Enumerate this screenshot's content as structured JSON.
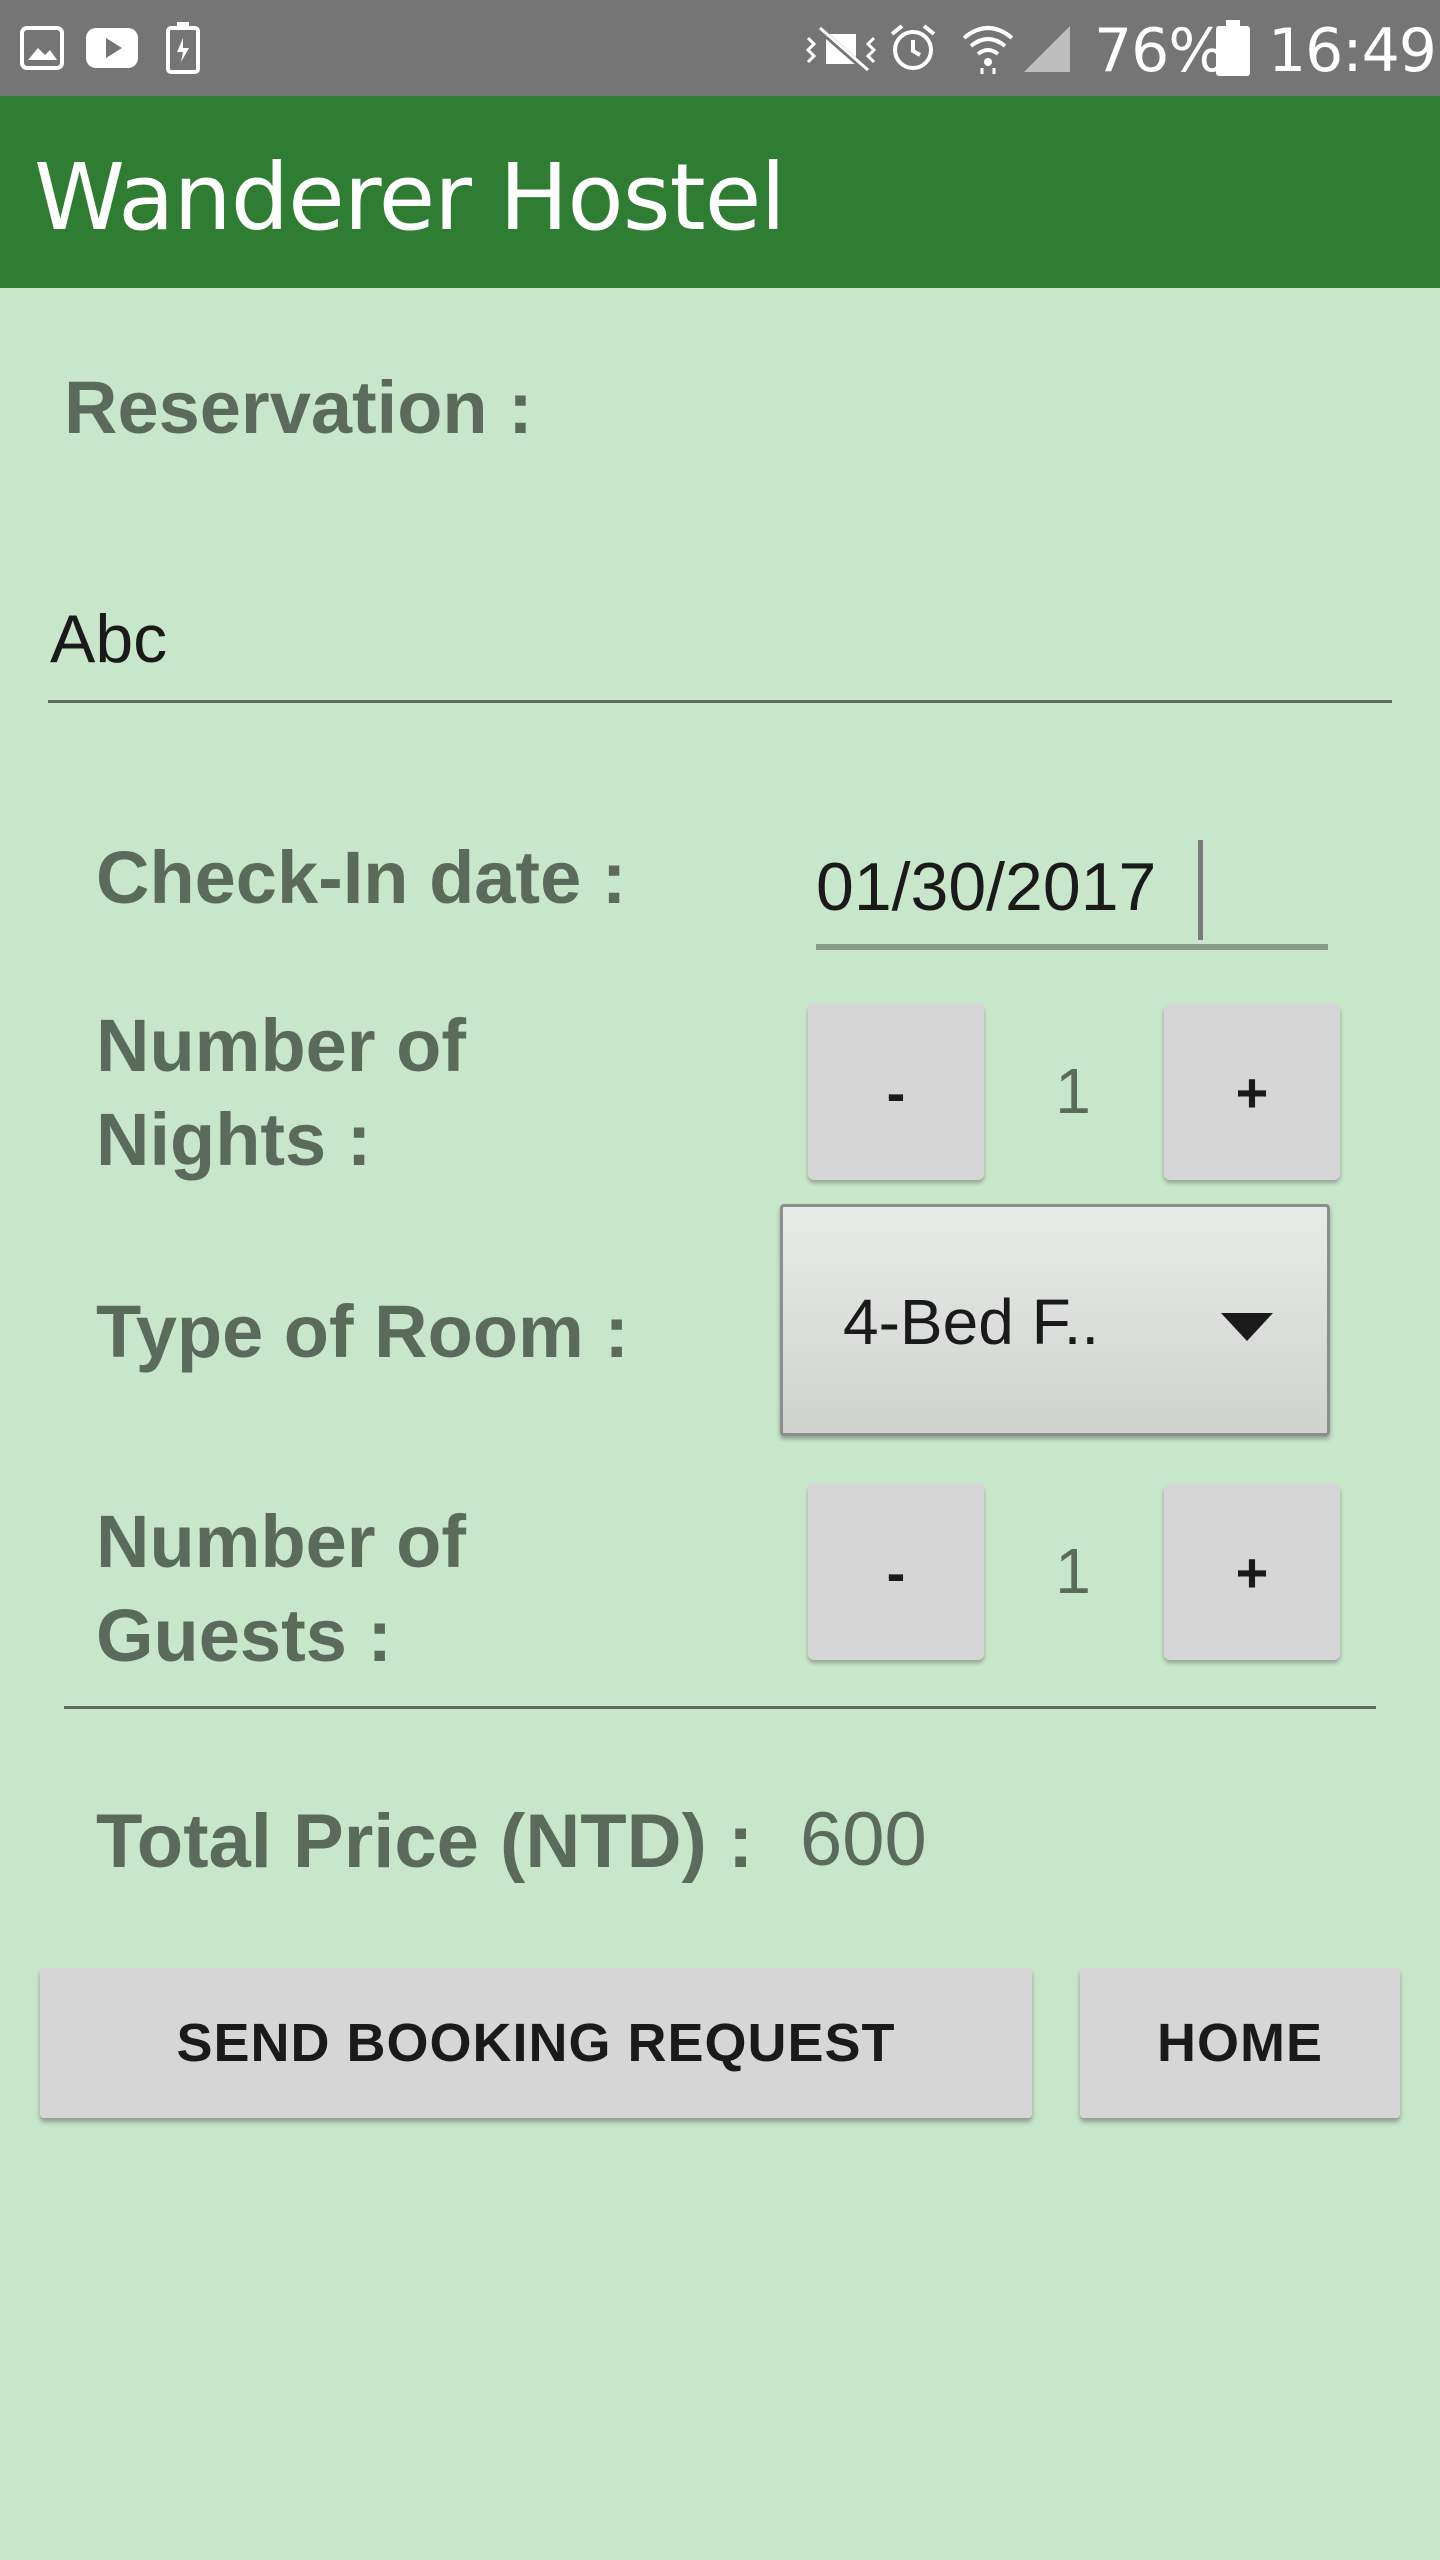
{
  "status_bar": {
    "battery_percent": "76%",
    "time": "16:49",
    "icons": [
      "gallery-icon",
      "youtube-icon",
      "battery-saver-icon",
      "vibrate-icon",
      "alarm-icon",
      "wifi-icon",
      "signal-icon",
      "battery-icon"
    ]
  },
  "app_bar": {
    "title": "Wanderer Hostel"
  },
  "form": {
    "section_title": "Reservation :",
    "name_value": "Abc",
    "checkin_label": "Check-In date :",
    "checkin_value": "01/30/2017",
    "nights_label_line1": "Number of",
    "nights_label_line2": "Nights :",
    "nights_minus": "-",
    "nights_value": "1",
    "nights_plus": "+",
    "room_label": "Type of Room :",
    "room_selected": "4-Bed F..",
    "guests_label_line1": "Number of",
    "guests_label_line2": "Guests :",
    "guests_minus": "-",
    "guests_value": "1",
    "guests_plus": "+",
    "total_label": "Total Price (NTD) :",
    "total_value": "600"
  },
  "actions": {
    "send_label": "SEND BOOKING REQUEST",
    "home_label": "HOME"
  },
  "colors": {
    "background": "#c8e6c9",
    "app_bar": "#2e7d32",
    "status_bar": "#757575",
    "label_text": "#5b6b5b",
    "button": "#d6d6d6"
  }
}
